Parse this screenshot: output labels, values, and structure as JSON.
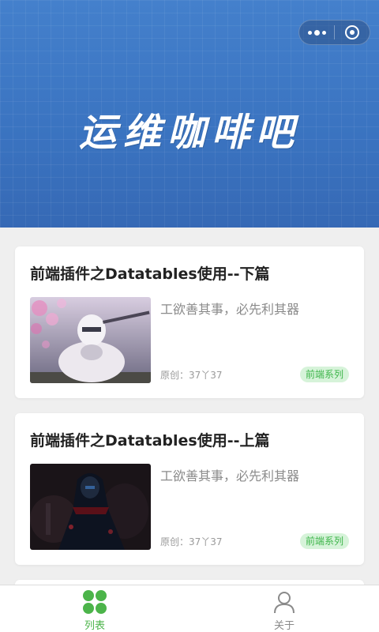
{
  "header": {
    "title": "运维咖啡吧"
  },
  "posts": [
    {
      "title": "前端插件之Datatables使用--下篇",
      "desc": "工欲善其事，必先利其器",
      "meta": "原创：37丫37",
      "tag": "前端系列",
      "thumb": "anime-warrior-cherry-blossom-image"
    },
    {
      "title": "前端插件之Datatables使用--上篇",
      "desc": "工欲善其事，必先利其器",
      "meta": "原创：37丫37",
      "tag": "前端系列",
      "thumb": "dark-hooded-warrior-image"
    }
  ],
  "tabbar": {
    "list_label": "列表",
    "about_label": "关于",
    "list_icon": "list-icon",
    "about_icon": "person-icon"
  },
  "colors": {
    "banner": "#3a74c2",
    "accent": "#4cb44a",
    "tag_bg": "#d6f3d9",
    "tag_text": "#3eb54a"
  }
}
